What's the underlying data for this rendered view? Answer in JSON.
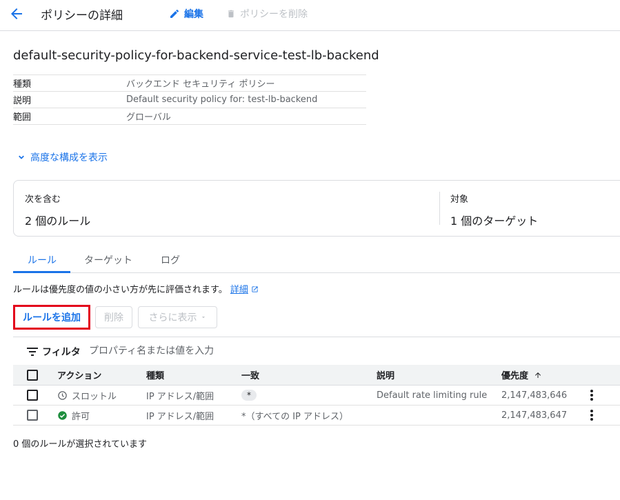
{
  "header": {
    "title": "ポリシーの詳細",
    "edit_label": "編集",
    "delete_label": "ポリシーを削除"
  },
  "policy": {
    "name": "default-security-policy-for-backend-service-test-lb-backend",
    "properties": [
      {
        "key": "種類",
        "value": "バックエンド セキュリティ ポリシー"
      },
      {
        "key": "説明",
        "value": "Default security policy for: test-lb-backend"
      },
      {
        "key": "範囲",
        "value": "グローバル"
      }
    ]
  },
  "advanced_label": "高度な構成を表示",
  "summary": {
    "contains_label": "次を含む",
    "contains_value": "2 個のルール",
    "targets_label": "対象",
    "targets_value": "1 個のターゲット"
  },
  "tabs": [
    "ルール",
    "ターゲット",
    "ログ"
  ],
  "note": {
    "text": "ルールは優先度の値の小さい方が先に評価されます。",
    "link": "詳細"
  },
  "toolbar": {
    "add_rule": "ルールを追加",
    "delete": "削除",
    "more": "さらに表示"
  },
  "filter": {
    "label": "フィルタ",
    "placeholder": "プロパティ名または値を入力"
  },
  "table": {
    "headers": [
      "アクション",
      "種類",
      "一致",
      "説明",
      "優先度"
    ],
    "rows": [
      {
        "action": "スロットル",
        "action_icon": "clock-icon",
        "type": "IP アドレス/範囲",
        "match": "*",
        "description": "Default rate limiting rule",
        "priority": "2,147,483,646"
      },
      {
        "action": "許可",
        "action_icon": "check-circle-icon",
        "type": "IP アドレス/範囲",
        "match": "*（すべての IP アドレス）",
        "description": "",
        "priority": "2,147,483,647"
      }
    ]
  },
  "selected_note": "0 個のルールが選択されています",
  "colors": {
    "accent": "#1a73e8",
    "highlight": "#e3001b",
    "allow": "#1e8e3e"
  }
}
